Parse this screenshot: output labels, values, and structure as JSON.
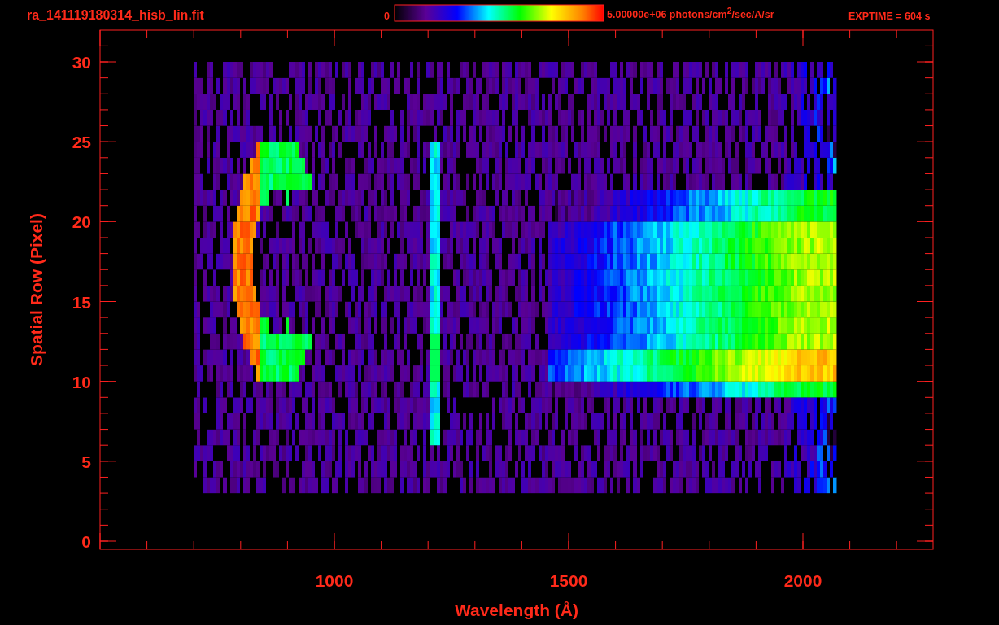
{
  "title": "ra_141119180314_hisb_lin.fit",
  "colorbar": {
    "min_label": "0",
    "max_label": "5.00000e+06 photons/cm$^{2}$/sec/A/sr"
  },
  "exptime": "EXPTIME = 604 s",
  "xaxis": {
    "label": "Wavelength (Å)",
    "ticks": [
      "1000",
      "1500",
      "2000"
    ]
  },
  "yaxis": {
    "label": "Spatial Row (Pixel)",
    "ticks": [
      "30",
      "25",
      "20",
      "15",
      "10",
      "5",
      "0"
    ]
  }
}
